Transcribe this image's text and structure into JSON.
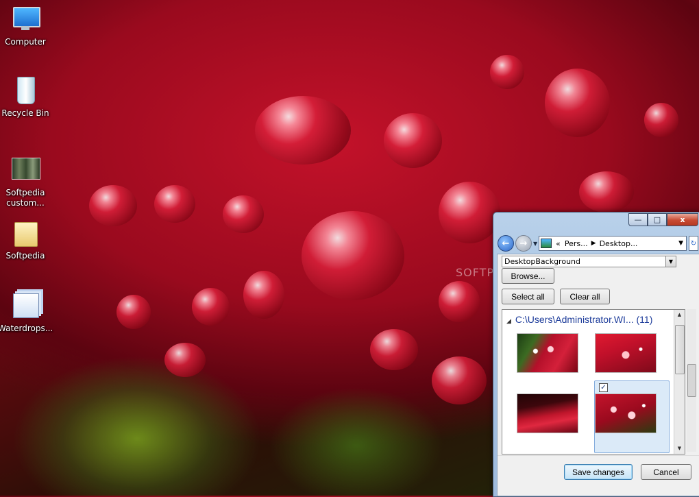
{
  "desktop": {
    "icons": [
      {
        "label": "Computer"
      },
      {
        "label": "Recycle Bin"
      },
      {
        "label": "Softpedia custom..."
      },
      {
        "label": "Softpedia"
      },
      {
        "label": "Waterdrops..."
      }
    ],
    "watermark": "SOFTPEDIA"
  },
  "window": {
    "caption": {
      "minimize": "—",
      "maximize": "□",
      "close": "x"
    },
    "nav": {
      "back": "←",
      "forward": "→",
      "breadcrumb": [
        "«",
        "Pers...",
        "Desktop..."
      ],
      "refresh": "↻"
    },
    "source_combo": "DesktopBackground",
    "browse_label": "Browse...",
    "select_all_label": "Select all",
    "clear_all_label": "Clear all",
    "gallery": {
      "header": "C:\\Users\\Administrator.WI... (11)",
      "checked_mark": "✓"
    },
    "save_label": "Save changes",
    "cancel_label": "Cancel"
  }
}
